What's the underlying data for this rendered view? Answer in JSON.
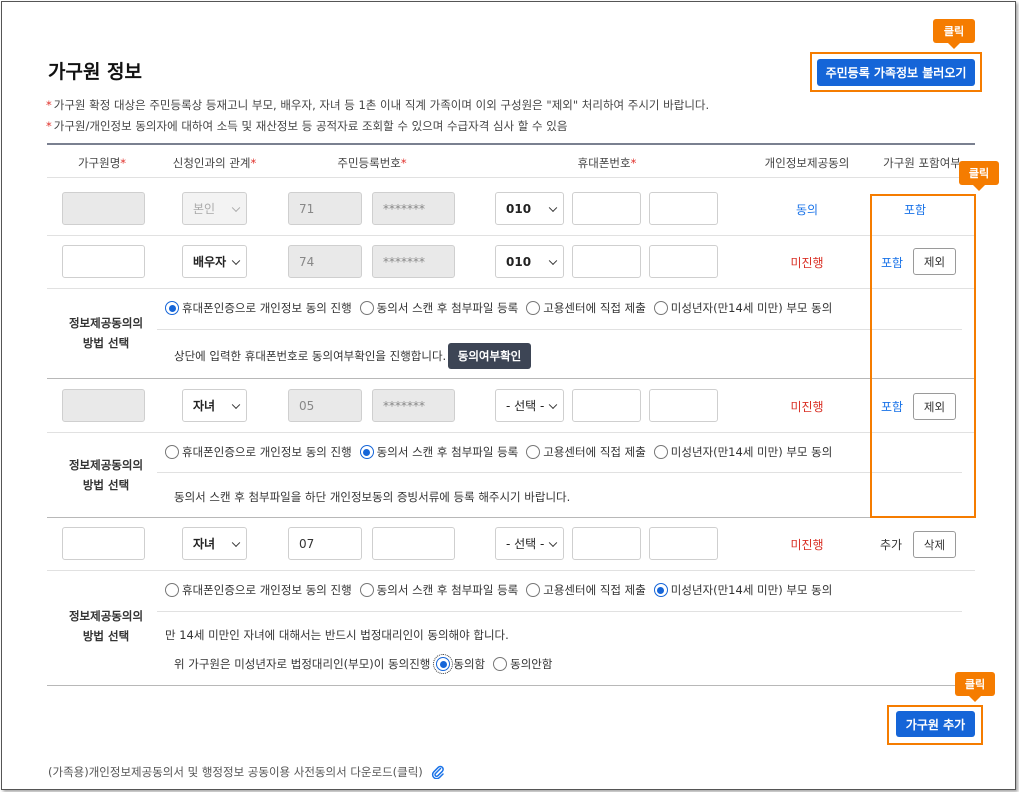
{
  "page_title": "가구원 정보",
  "notices": [
    "가구원 확정 대상은 주민등록상 등재고니 부모, 배우자, 자녀 등 1촌 이내 직계 가족이며 이외 구성원은 \"제외\" 처리하여 주시기 바랍니다.",
    "가구원/개인정보 동의자에 대하여 소득 및 재산정보 등 공적자료 조회할 수 있으며 수급자격 심사 할 수 있음"
  ],
  "notice_star": "*",
  "load_button": "주민등록 가족정보 불러오기",
  "click_label": "클릭",
  "headers": {
    "name": "가구원명",
    "relation": "신청인과의 관계",
    "rrn": "주민등록번호",
    "phone": "휴대폰번호",
    "consent": "개인정보제공동의",
    "include": "가구원 포함여부",
    "req": "*"
  },
  "members": [
    {
      "name": "",
      "relation": "본인",
      "rrn1": "71",
      "rrn2": "*******",
      "phone1": "010",
      "phone2": "",
      "phone3": "",
      "consent": "동의",
      "include": "포함",
      "action": ""
    },
    {
      "name": "",
      "relation": "배우자",
      "rrn1": "74",
      "rrn2": "*******",
      "phone1": "010",
      "phone2": "",
      "phone3": "",
      "consent": "미진행",
      "include": "포함",
      "action": "제외"
    },
    {
      "name": "",
      "relation": "자녀",
      "rrn1": "05",
      "rrn2": "*******",
      "phone1": "- 선택 -",
      "phone2": "",
      "phone3": "",
      "consent": "미진행",
      "include": "포함",
      "action": "제외"
    },
    {
      "name": "",
      "relation": "자녀",
      "rrn1": "07",
      "rrn2": "",
      "phone1": "- 선택 -",
      "phone2": "",
      "phone3": "",
      "consent": "미진행",
      "include": "추가",
      "action": "삭제"
    }
  ],
  "method_label_1": "정보제공동의의",
  "method_label_2": "방법 선택",
  "method_options": [
    "휴대폰인증으로 개인정보 동의 진행",
    "동의서 스캔 후 첨부파일 등록",
    "고용센터에 직접 제출",
    "미성년자(만14세 미만) 부모 동의"
  ],
  "method_blocks": [
    {
      "selected": 0,
      "info": "상단에 입력한 휴대폰번호로 동의여부확인을 진행합니다.",
      "button": "동의여부확인"
    },
    {
      "selected": 1,
      "info": "동의서 스캔 후 첨부파일을 하단 개인정보동의 증빙서류에 등록 해주시기 바랍니다."
    },
    {
      "selected": 3,
      "info": "만 14세 미만인 자녀에 대해서는 반드시 법정대리인이 동의해야 합니다.",
      "guardian_text": "위 가구원은 미성년자로 법정대리인(부모)이 동의진행",
      "guardian_options": [
        "동의함",
        "동의안함"
      ],
      "guardian_selected": 0
    }
  ],
  "add_button": "가구원 추가",
  "download_text": "(가족용)개인정보제공동의서 및 행정정보 공동이용 사전동의서 다운로드(클릭)",
  "colors": {
    "primary": "#1565d8",
    "highlight": "#f57c00",
    "status_blue": "#1a73e8",
    "status_red": "#d93025",
    "button_dark": "#3d4555"
  },
  "icons": {
    "download": "paperclip-icon",
    "dropdown": "chevron-down-icon"
  }
}
